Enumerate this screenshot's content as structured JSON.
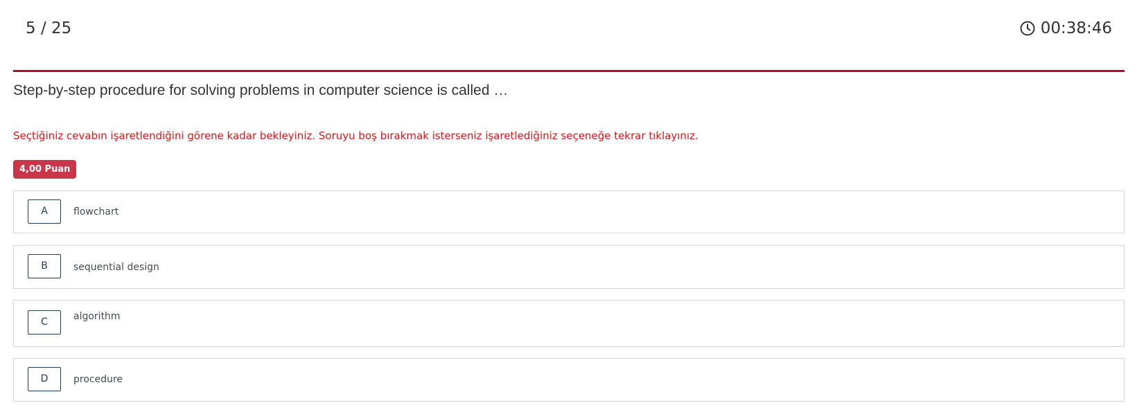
{
  "header": {
    "progress": "5 / 25",
    "timer": "00:38:46",
    "timer_icon": "clock-icon",
    "accent_color": "#a8102e"
  },
  "question": {
    "text": "Step-by-step procedure for solving problems in computer science is called …",
    "notice": "Seçtiğiniz cevabın işaretlendiğini görene kadar bekleyiniz. Soruyu boş bırakmak isterseniz işaretlediğiniz seçeneğe tekrar tıklayınız.",
    "points": "4,00 Puan"
  },
  "options": [
    {
      "letter": "A",
      "text": "flowchart"
    },
    {
      "letter": "B",
      "text": "sequential design"
    },
    {
      "letter": "C",
      "text": "algorithm"
    },
    {
      "letter": "D",
      "text": "procedure"
    }
  ]
}
